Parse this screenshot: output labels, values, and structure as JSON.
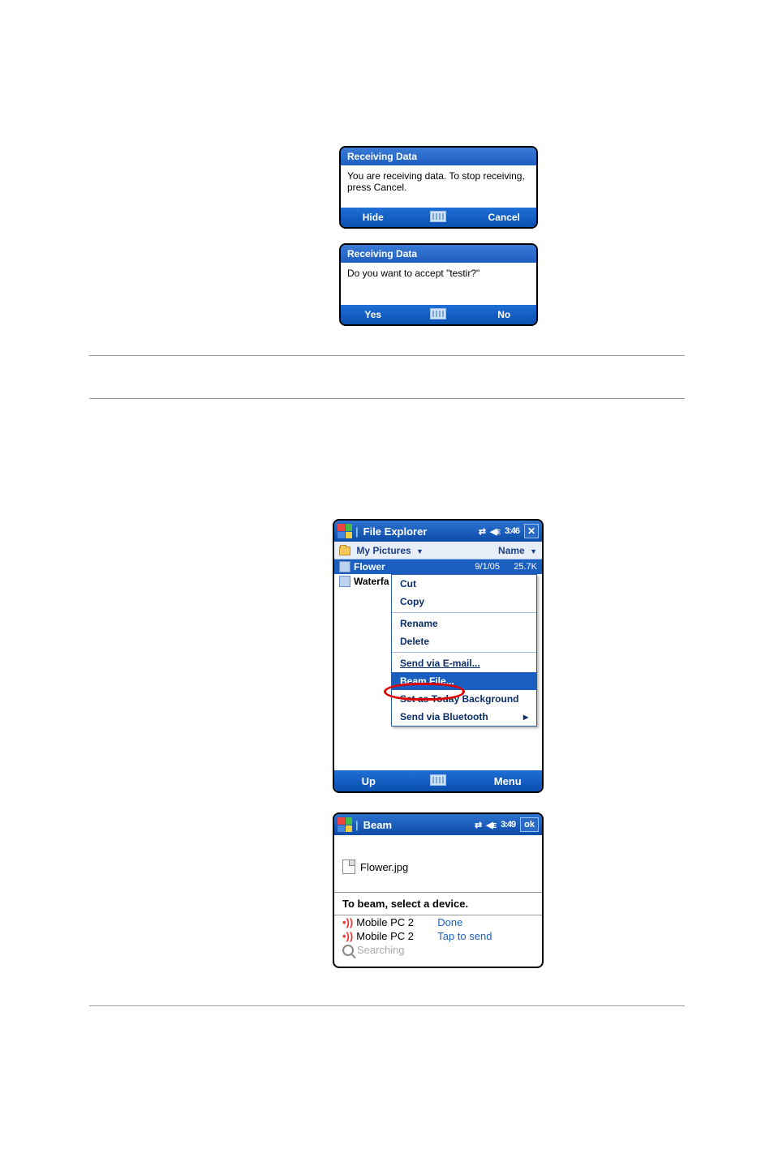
{
  "dialogs": [
    {
      "title": "Receiving Data",
      "body": "You are receiving data. To stop receiving, press Cancel.",
      "left": "Hide",
      "right": "Cancel"
    },
    {
      "title": "Receiving Data",
      "body": "Do you want to accept \"testir?\"",
      "left": "Yes",
      "right": "No"
    }
  ],
  "fileExplorer": {
    "title": "File Explorer",
    "time": "3:46",
    "closeGlyph": "✕",
    "locationLabel": "My Pictures",
    "sortLabel": "Name",
    "files": [
      {
        "name": "Flower",
        "date": "9/1/05",
        "size": "25.7K",
        "selected": true,
        "icon": "image"
      },
      {
        "name": "Waterfa",
        "date": "",
        "size": "",
        "selected": false,
        "icon": "image"
      }
    ],
    "contextMenu": [
      {
        "label": "Cut",
        "style": ""
      },
      {
        "label": "Copy",
        "style": ""
      },
      {
        "sep": true
      },
      {
        "label": "Rename",
        "style": ""
      },
      {
        "label": "Delete",
        "style": ""
      },
      {
        "sep": true
      },
      {
        "label": "Send via E-mail...",
        "style": "u"
      },
      {
        "label": "Beam File...",
        "style": "hi"
      },
      {
        "label": "Set as Today Background",
        "style": ""
      },
      {
        "label": "Send via Bluetooth",
        "style": "sub"
      }
    ],
    "bottom": {
      "left": "Up",
      "right": "Menu"
    }
  },
  "beam": {
    "title": "Beam",
    "time": "3:49",
    "ok": "ok",
    "file": "Flower.jpg",
    "prompt": "To beam, select a device.",
    "devices": [
      {
        "name": "Mobile PC 2",
        "status": "Done",
        "icon": "ir"
      },
      {
        "name": "Mobile PC 2",
        "status": "Tap to send",
        "icon": "ir"
      },
      {
        "name": "Searching",
        "status": "",
        "icon": "search",
        "muted": true
      }
    ]
  }
}
